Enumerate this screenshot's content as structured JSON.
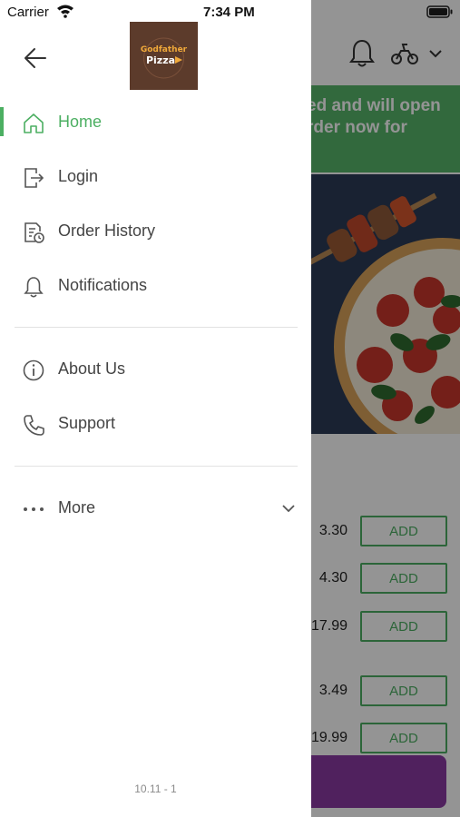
{
  "status_bar": {
    "carrier": "Carrier",
    "time": "7:34 PM"
  },
  "logo": {
    "line1": "Godfather",
    "line2": "Pizza"
  },
  "menu": {
    "items": [
      {
        "label": "Home",
        "icon": "home-icon",
        "active": true
      },
      {
        "label": "Login",
        "icon": "login-icon"
      },
      {
        "label": "Order History",
        "icon": "order-history-icon"
      },
      {
        "label": "Notifications",
        "icon": "bell-icon"
      },
      {
        "label": "About Us",
        "icon": "info-icon"
      },
      {
        "label": "Support",
        "icon": "phone-icon"
      },
      {
        "label": "More",
        "icon": "more-dots-icon"
      }
    ]
  },
  "version": "10.11 - 1",
  "background": {
    "banner_line1": "ed and will open",
    "banner_line2": "rder now for",
    "items": [
      {
        "price": "3.30",
        "button": "ADD"
      },
      {
        "price": "4.30",
        "button": "ADD"
      },
      {
        "price": "17.99",
        "button": "ADD"
      },
      {
        "price": "3.49",
        "button": "ADD"
      },
      {
        "price": "19.99",
        "button": "ADD"
      }
    ]
  },
  "colors": {
    "accent": "#4caf62",
    "banner": "#56b56a",
    "cart": "#8a3aa3"
  }
}
